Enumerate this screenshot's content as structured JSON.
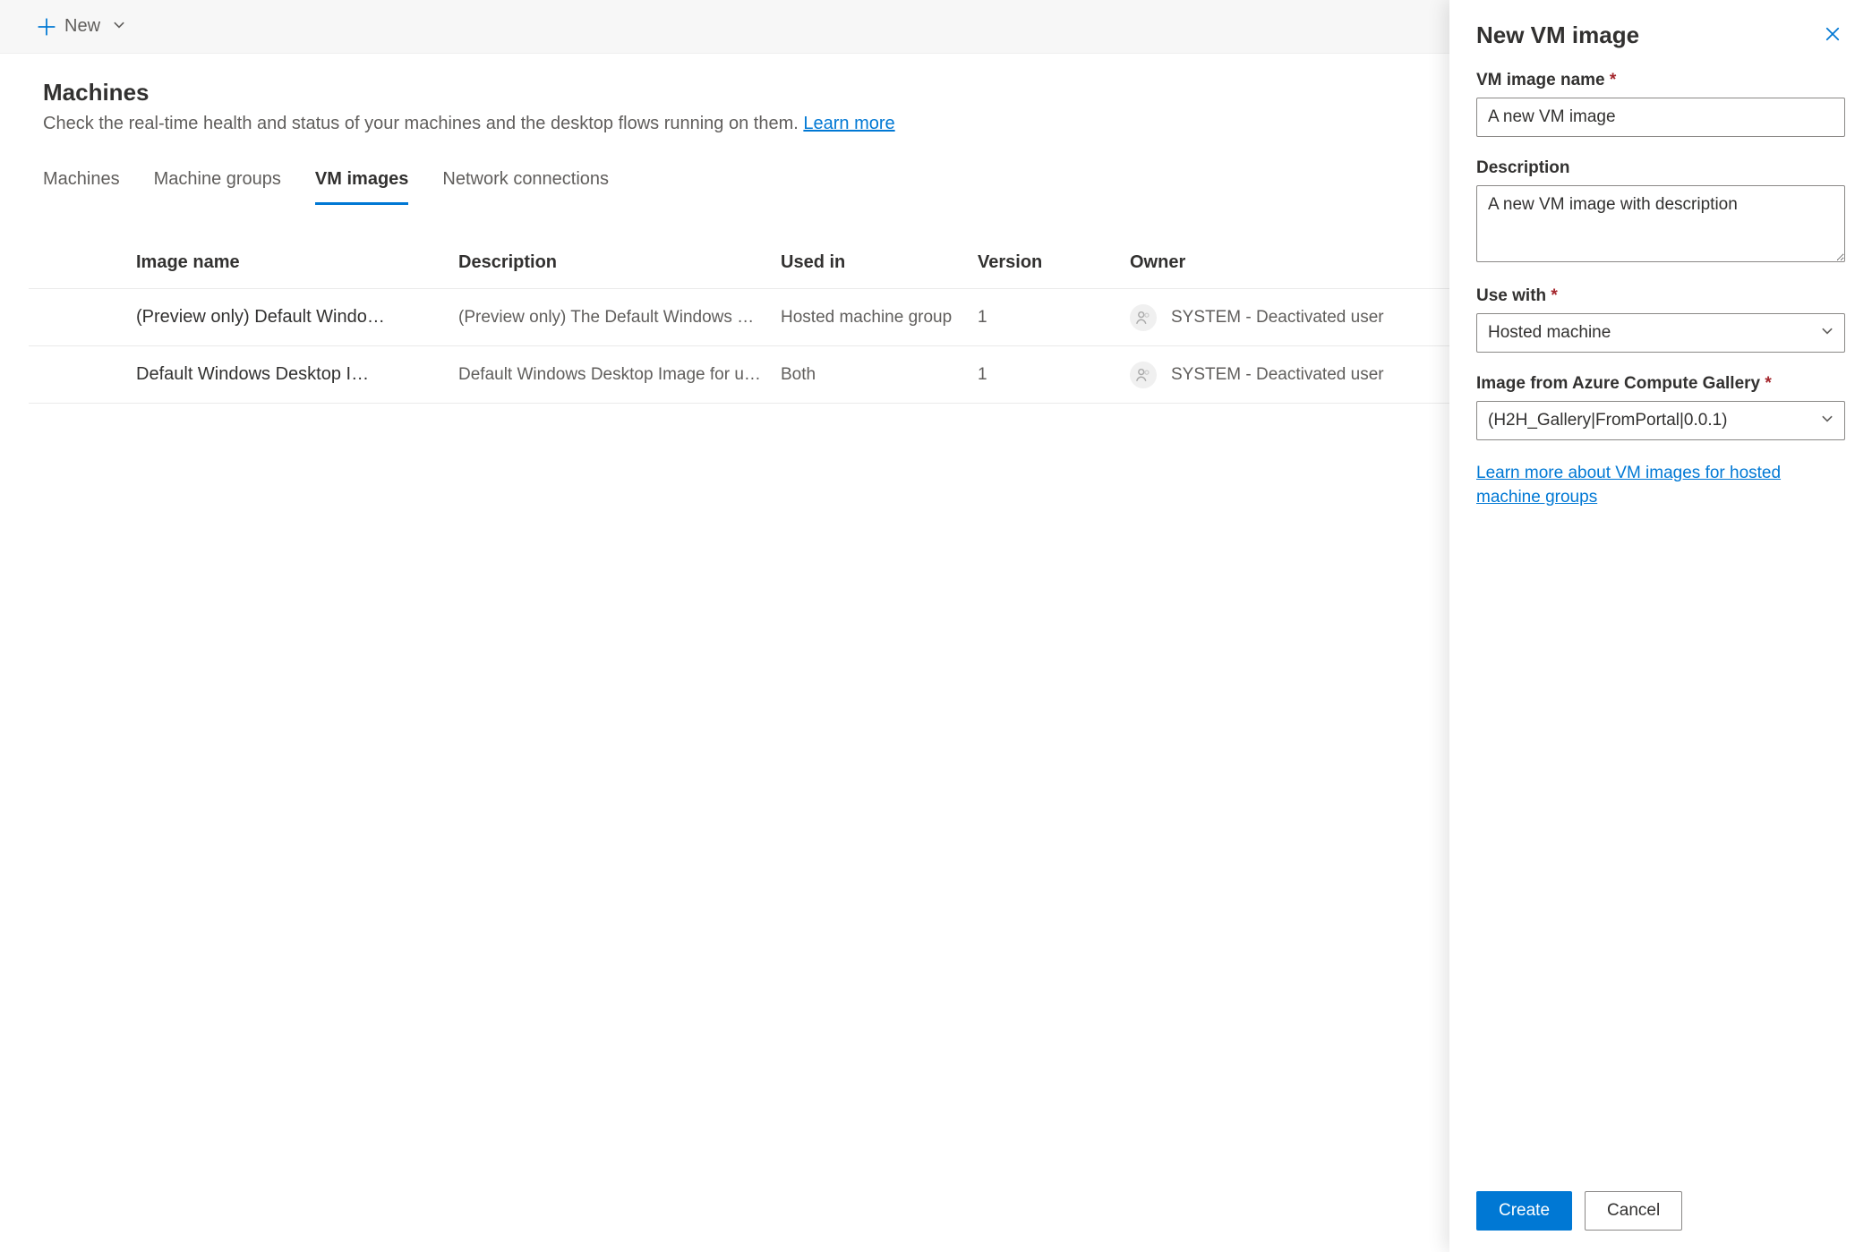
{
  "toolbar": {
    "new_label": "New"
  },
  "header": {
    "title": "Machines",
    "subtitle": "Check the real-time health and status of your machines and the desktop flows running on them. ",
    "learn_more": "Learn more"
  },
  "tabs": [
    {
      "label": "Machines",
      "active": false
    },
    {
      "label": "Machine groups",
      "active": false
    },
    {
      "label": "VM images",
      "active": true
    },
    {
      "label": "Network connections",
      "active": false
    }
  ],
  "table": {
    "columns": {
      "name": "Image name",
      "description": "Description",
      "used_in": "Used in",
      "version": "Version",
      "owner": "Owner"
    },
    "rows": [
      {
        "name": "(Preview only) Default Windo…",
        "description": "(Preview only) The Default Windows Desk…",
        "used_in": "Hosted machine group",
        "version": "1",
        "owner": "SYSTEM - Deactivated user"
      },
      {
        "name": "Default Windows Desktop I…",
        "description": "Default Windows Desktop Image for use i…",
        "used_in": "Both",
        "version": "1",
        "owner": "SYSTEM - Deactivated user"
      }
    ]
  },
  "panel": {
    "title": "New VM image",
    "fields": {
      "name_label": "VM image name",
      "name_value": "A new VM image",
      "desc_label": "Description",
      "desc_value": "A new VM image with description",
      "use_with_label": "Use with",
      "use_with_value": "Hosted machine",
      "gallery_label": "Image from Azure Compute Gallery",
      "gallery_value": "(H2H_Gallery|FromPortal|0.0.1)"
    },
    "link": "Learn more about VM images for hosted machine groups",
    "buttons": {
      "create": "Create",
      "cancel": "Cancel"
    }
  }
}
